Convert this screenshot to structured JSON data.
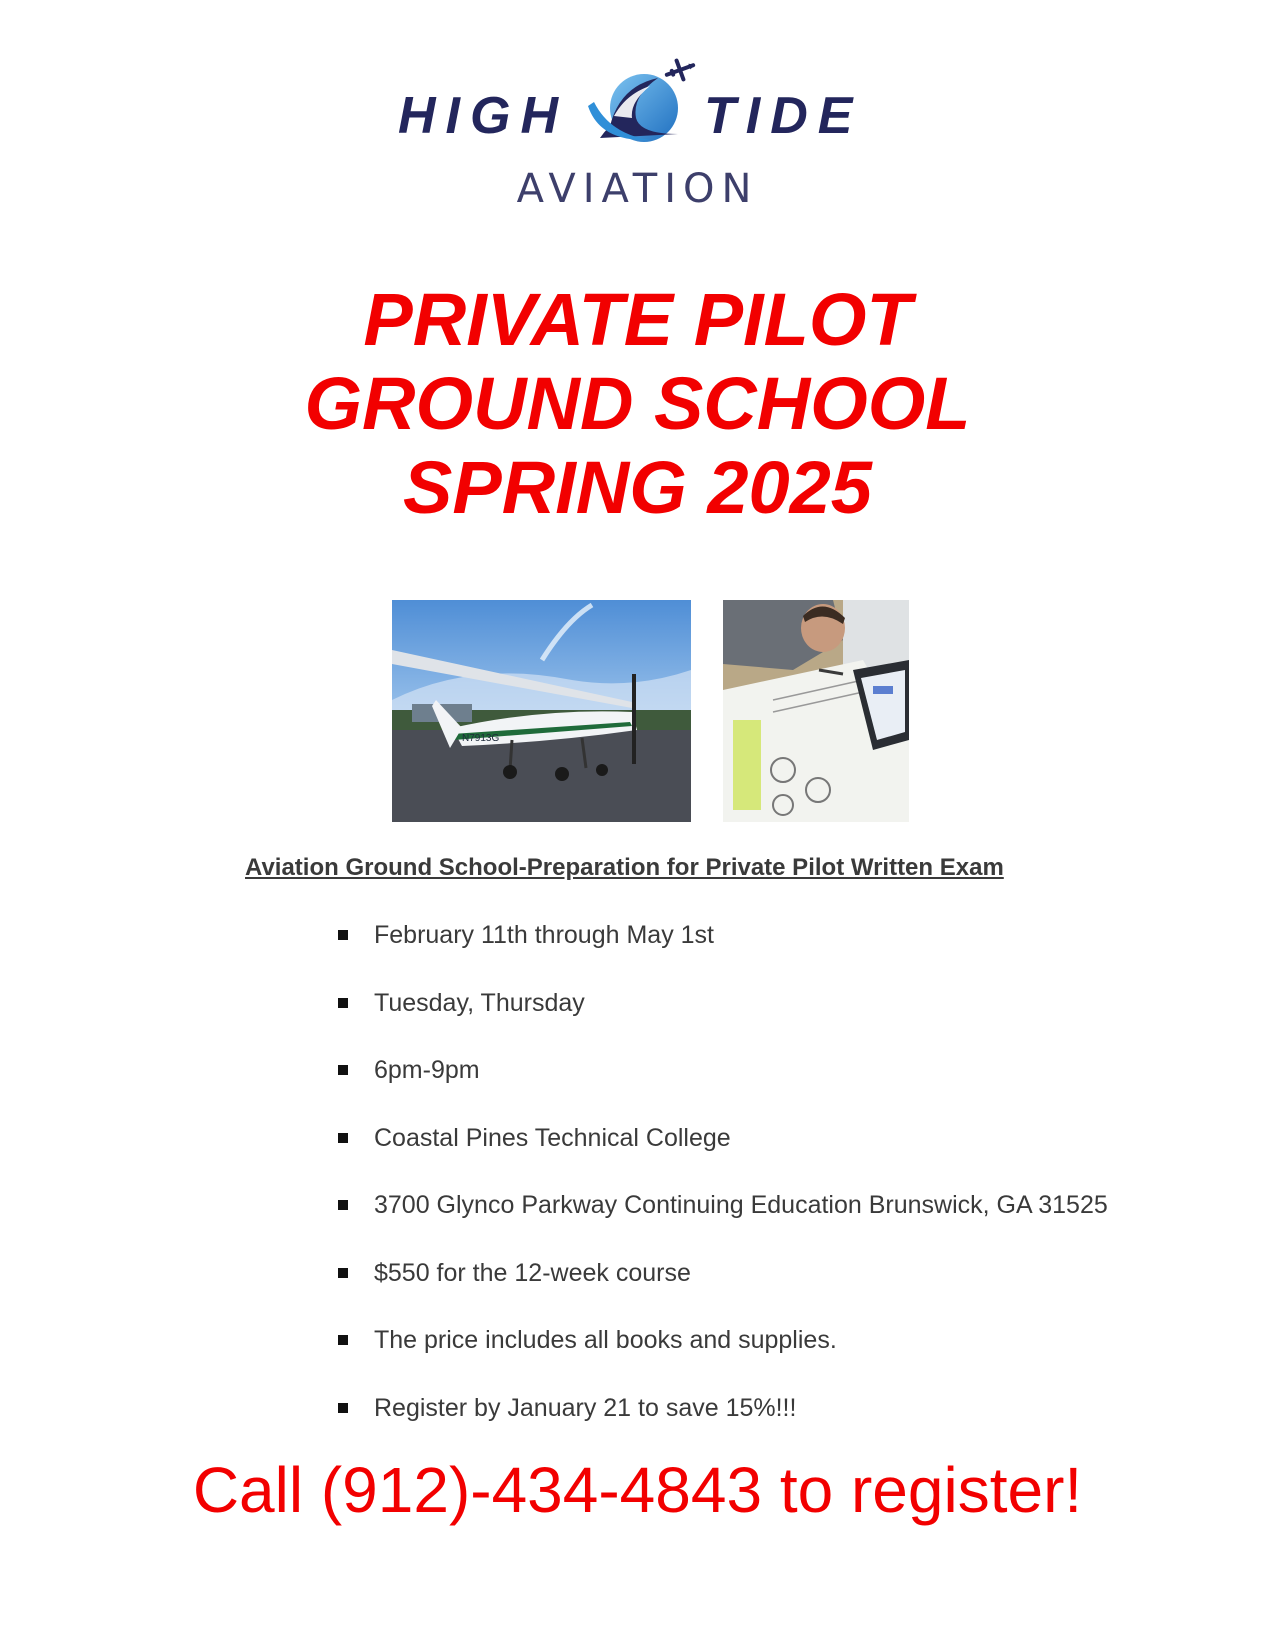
{
  "logo": {
    "word_left": "HIGH",
    "word_right": "TIDE",
    "subtitle": "AVIATION"
  },
  "title": {
    "line1": "PRIVATE PILOT",
    "line2": "GROUND SCHOOL",
    "line3": "SPRING 2025"
  },
  "photos": {
    "plane_registration": "N7913G"
  },
  "course_heading": "Aviation Ground School-Preparation for Private Pilot Written Exam",
  "details": [
    "February 11th through May 1st",
    "Tuesday, Thursday",
    "6pm-9pm",
    "Coastal Pines Technical College",
    "3700 Glynco Parkway Continuing Education Brunswick, GA 31525",
    "$550 for the 12-week course",
    "The price includes all books and supplies.",
    "Register by January 21 to save 15%!!!"
  ],
  "call_to_action": "Call (912)-434-4843 to register!",
  "colors": {
    "headline_red": "#f20000",
    "logo_navy": "#23265c",
    "logo_blue": "#2f8fd8"
  }
}
